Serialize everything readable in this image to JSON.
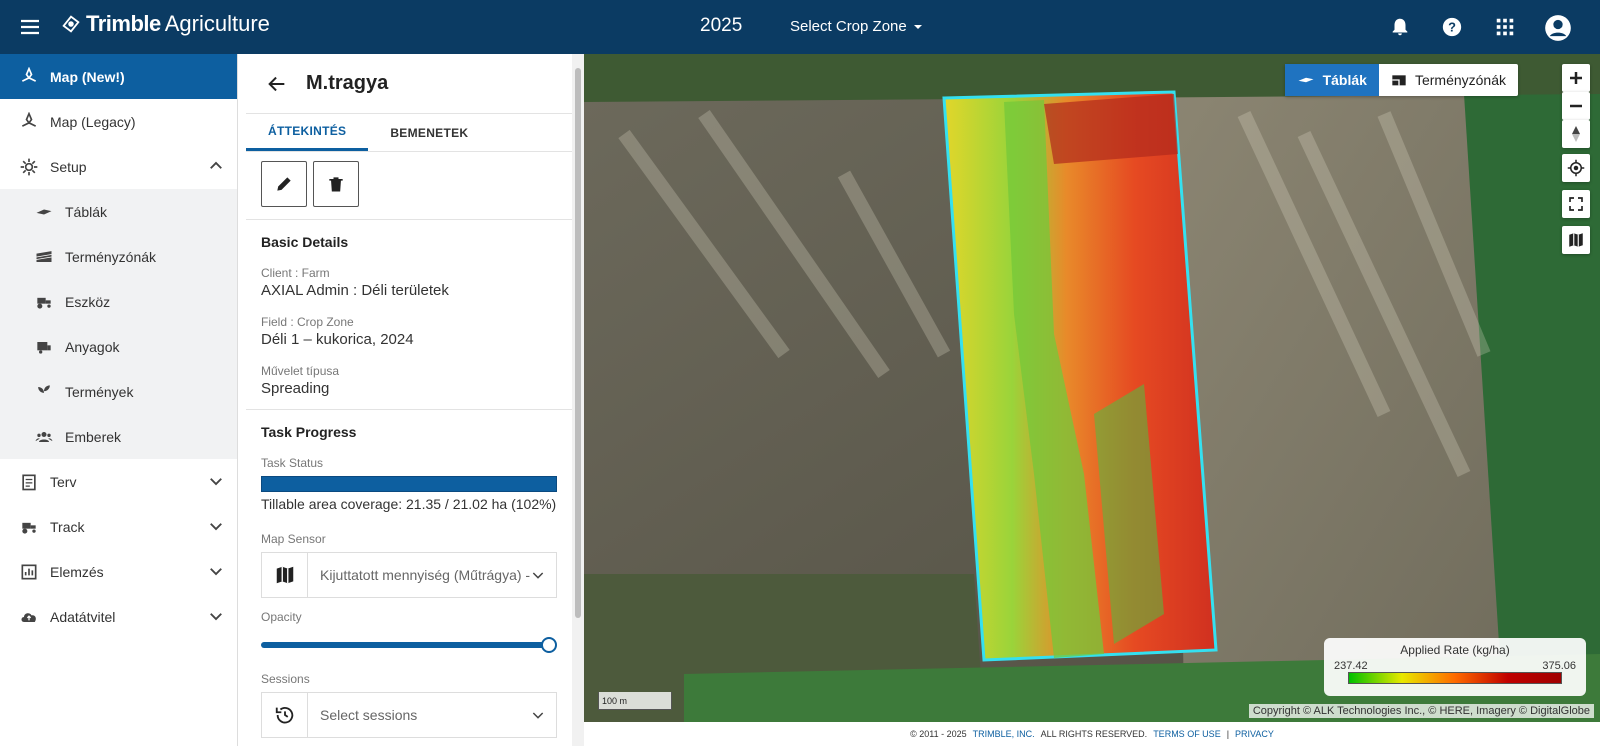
{
  "header": {
    "brand": "Trimble",
    "product": "Agriculture",
    "year": "2025",
    "crop_zone": "Select Crop Zone"
  },
  "sidebar": {
    "items": [
      {
        "label": "Map (New!)",
        "icon": "map-pin-icon",
        "active": true
      },
      {
        "label": "Map (Legacy)",
        "icon": "map-pin-icon"
      },
      {
        "label": "Setup",
        "icon": "gear-icon",
        "expanded": true
      },
      {
        "label": "Táblák",
        "icon": "field-icon"
      },
      {
        "label": "Terményzónák",
        "icon": "crop-zone-icon"
      },
      {
        "label": "Eszköz",
        "icon": "tractor-icon"
      },
      {
        "label": "Anyagok",
        "icon": "materials-icon"
      },
      {
        "label": "Termények",
        "icon": "sprout-icon"
      },
      {
        "label": "Emberek",
        "icon": "people-icon"
      },
      {
        "label": "Terv",
        "icon": "clipboard-icon"
      },
      {
        "label": "Track",
        "icon": "tractor-icon"
      },
      {
        "label": "Elemzés",
        "icon": "chart-icon"
      },
      {
        "label": "Adatátvitel",
        "icon": "cloud-upload-icon"
      }
    ]
  },
  "panel": {
    "title": "M.tragya",
    "tabs": [
      "ÁTTEKINTÉS",
      "BEMENETEK"
    ],
    "basic_details": {
      "title": "Basic Details",
      "client_label": "Client : Farm",
      "client_value": "AXIAL Admin : Déli területek",
      "field_label": "Field : Crop Zone",
      "field_value": "Déli 1 – kukorica, 2024",
      "operation_label": "Művelet típusa",
      "operation_value": "Spreading"
    },
    "task_progress": {
      "title": "Task Progress",
      "status_label": "Task Status",
      "coverage": "Tillable area coverage: 21.35 / 21.02 ha (102%)",
      "sensor_label": "Map Sensor",
      "sensor_value": "Kijuttatott mennyiség (Műtrágya) - ",
      "opacity_label": "Opacity",
      "sessions_label": "Sessions",
      "sessions_placeholder": "Select sessions"
    }
  },
  "map": {
    "layers": [
      "Táblák",
      "Terményzónák"
    ],
    "legend": {
      "title": "Applied Rate (kg/ha)",
      "min": "237.42",
      "max": "375.06"
    },
    "scale": "100 m",
    "copyright": "Copyright © ALK Technologies Inc., © HERE, Imagery © DigitalGlobe"
  },
  "footer": {
    "copyright": "© 2011 - 2025",
    "company": "TRIMBLE, INC.",
    "rights": "ALL RIGHTS RESERVED.",
    "terms": "TERMS OF USE",
    "sep": "|",
    "privacy": "PRIVACY"
  }
}
